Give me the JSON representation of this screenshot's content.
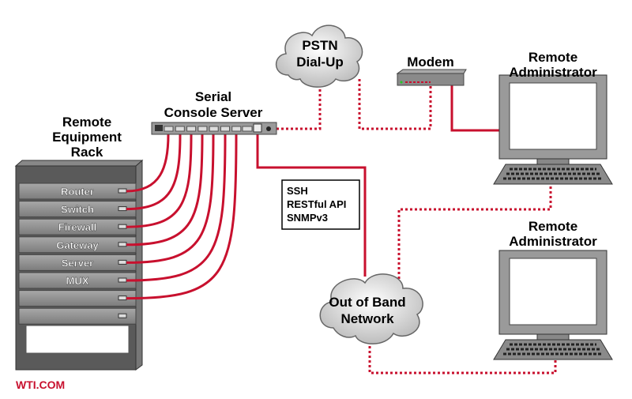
{
  "labels": {
    "rack_title": [
      "Remote",
      "Equipment",
      "Rack"
    ],
    "console_title": [
      "Serial",
      "Console Server"
    ],
    "pstn": [
      "PSTN",
      "Dial-Up"
    ],
    "modem": "Modem",
    "admin1": [
      "Remote",
      "Administrator"
    ],
    "admin2": [
      "Remote",
      "Administrator"
    ],
    "oob": [
      "Out of Band",
      "Network"
    ],
    "protocols": [
      "SSH",
      "RESTful API",
      "SNMPv3"
    ],
    "brand": "WTI.COM"
  },
  "rack_units": [
    "Router",
    "Switch",
    "Firewall",
    "Gateway",
    "Server",
    "MUX",
    "",
    ""
  ],
  "colors": {
    "cable": "#c8102e",
    "brand": "#c8102e",
    "device": "#8a8a8a"
  }
}
